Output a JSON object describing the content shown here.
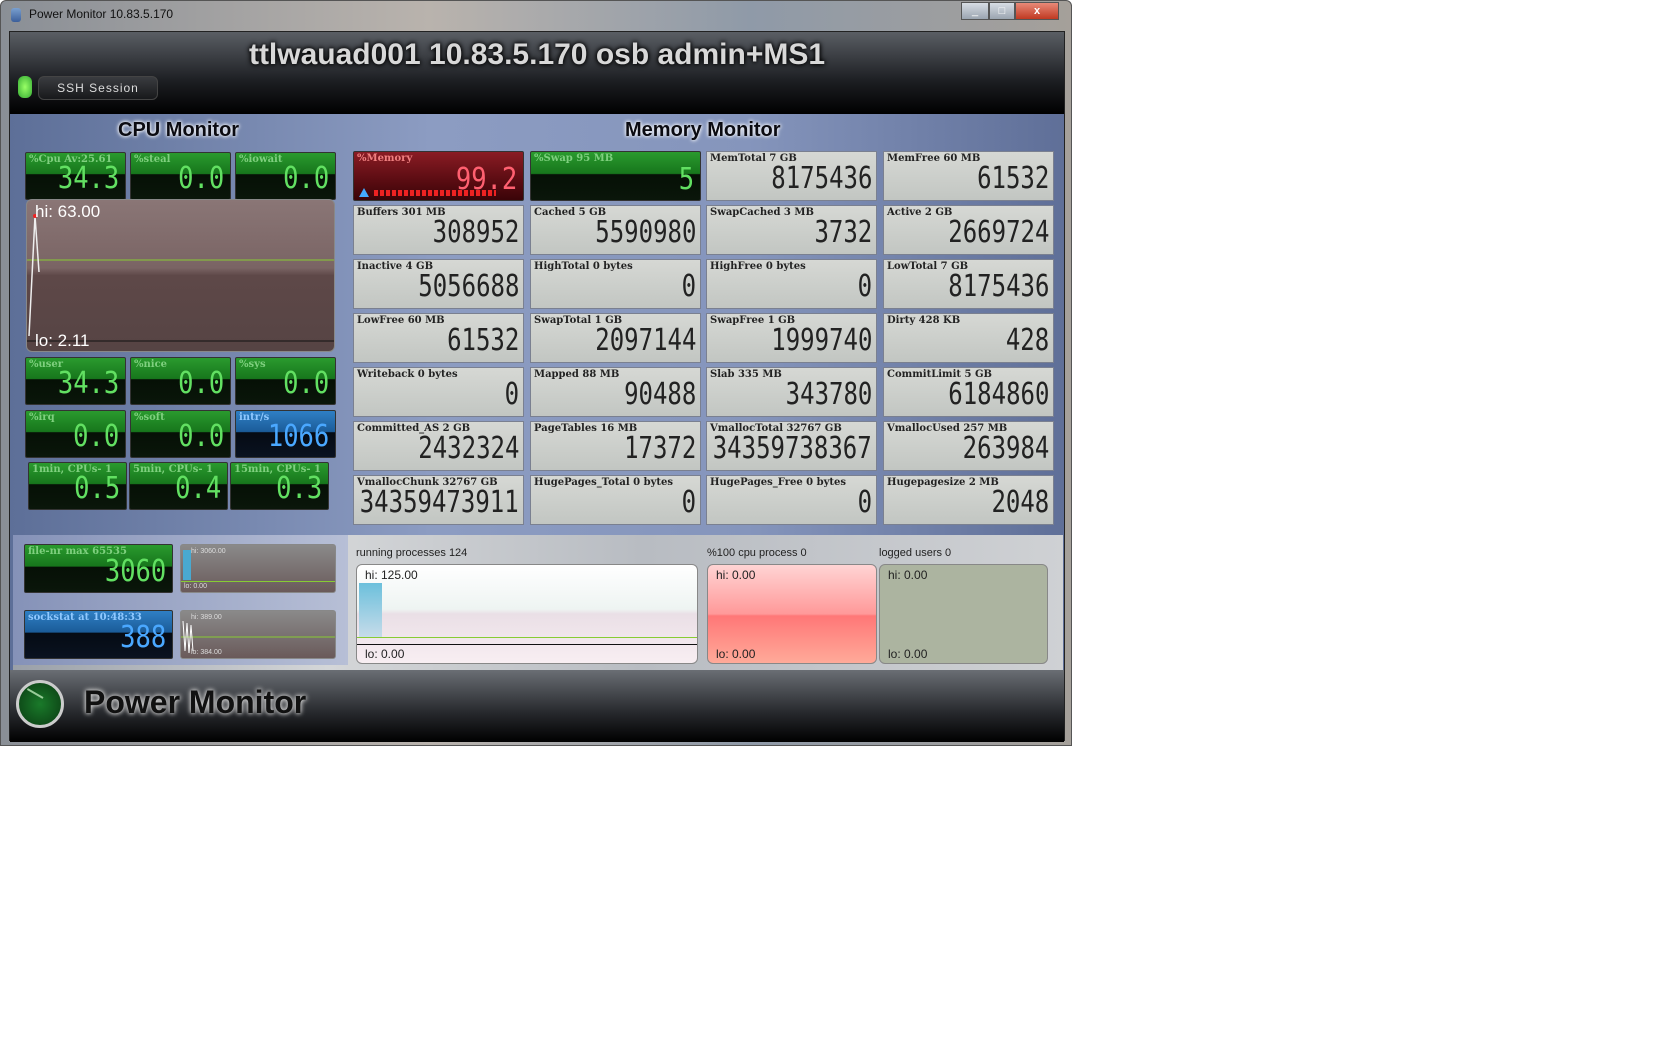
{
  "window": {
    "title": "Power Monitor 10.83.5.170",
    "minimize": "_",
    "maximize": "□",
    "close": "x"
  },
  "header": {
    "title": "ttlwauad001 10.83.5.170 osb admin+MS1",
    "ssh_button": "SSH Session"
  },
  "cpu": {
    "title": "CPU Monitor",
    "tiles": [
      {
        "label": "%Cpu Av:25.61",
        "value": "34.3",
        "style": "green"
      },
      {
        "label": "%steal",
        "value": "0.0",
        "style": "green"
      },
      {
        "label": "%iowait",
        "value": "0.0",
        "style": "green"
      },
      {
        "label": "%user",
        "value": "34.3",
        "style": "green"
      },
      {
        "label": "%nice",
        "value": "0.0",
        "style": "green"
      },
      {
        "label": "%sys",
        "value": "0.0",
        "style": "green"
      },
      {
        "label": "%irq",
        "value": "0.0",
        "style": "green"
      },
      {
        "label": "%soft",
        "value": "0.0",
        "style": "green"
      },
      {
        "label": "intr/s",
        "value": "1066",
        "style": "blue"
      },
      {
        "label": "1min, CPUs- 1",
        "value": "0.5",
        "style": "green"
      },
      {
        "label": "5min, CPUs- 1",
        "value": "0.4",
        "style": "green"
      },
      {
        "label": "15min, CPUs- 1",
        "value": "0.3",
        "style": "green"
      }
    ],
    "graph": {
      "hi": "hi: 63.00",
      "lo": "lo: 2.11"
    }
  },
  "memory": {
    "title": "Memory Monitor",
    "tiles": [
      {
        "label": "%Memory",
        "value": "99.2",
        "style": "red"
      },
      {
        "label": "%Swap 95 MB",
        "value": "5",
        "style": "green"
      },
      {
        "label": "MemTotal 7 GB",
        "value": "8175436"
      },
      {
        "label": "MemFree 60 MB",
        "value": "61532"
      },
      {
        "label": "Buffers 301 MB",
        "value": "308952"
      },
      {
        "label": "Cached 5 GB",
        "value": "5590980"
      },
      {
        "label": "SwapCached 3 MB",
        "value": "3732"
      },
      {
        "label": "Active 2 GB",
        "value": "2669724"
      },
      {
        "label": "Inactive 4 GB",
        "value": "5056688"
      },
      {
        "label": "HighTotal 0 bytes",
        "value": "0"
      },
      {
        "label": "HighFree 0 bytes",
        "value": "0"
      },
      {
        "label": "LowTotal 7 GB",
        "value": "8175436"
      },
      {
        "label": "LowFree 60 MB",
        "value": "61532"
      },
      {
        "label": "SwapTotal 1 GB",
        "value": "2097144"
      },
      {
        "label": "SwapFree 1 GB",
        "value": "1999740"
      },
      {
        "label": "Dirty 428 KB",
        "value": "428"
      },
      {
        "label": "Writeback 0 bytes",
        "value": "0"
      },
      {
        "label": "Mapped 88 MB",
        "value": "90488"
      },
      {
        "label": "Slab 335 MB",
        "value": "343780"
      },
      {
        "label": "CommitLimit 5 GB",
        "value": "6184860"
      },
      {
        "label": "Committed_AS 2 GB",
        "value": "2432324"
      },
      {
        "label": "PageTables 16 MB",
        "value": "17372"
      },
      {
        "label": "VmallocTotal 32767 GB",
        "value": "34359738367"
      },
      {
        "label": "VmallocUsed 257 MB",
        "value": "263984"
      },
      {
        "label": "VmallocChunk 32767 GB",
        "value": "34359473911"
      },
      {
        "label": "HugePages_Total 0 bytes",
        "value": "0"
      },
      {
        "label": "HugePages_Free 0 bytes",
        "value": "0"
      },
      {
        "label": "Hugepagesize 2 MB",
        "value": "2048"
      }
    ]
  },
  "files": {
    "label": "file-nr max 65535",
    "value": "3060",
    "graph_hi": "hi: 3060.00",
    "graph_lo": "lo: 0.00"
  },
  "sockstat": {
    "label": "sockstat at 10:48:33",
    "value": "388",
    "graph_hi": "hi: 389.00",
    "graph_lo": "lo: 384.00"
  },
  "processes": {
    "label": "running processes 124",
    "hi": "hi: 125.00",
    "lo": "lo: 0.00"
  },
  "cpu_process": {
    "label": "%100 cpu process 0",
    "hi": "hi: 0.00",
    "lo": "lo: 0.00"
  },
  "logged_users": {
    "label": "logged users 0",
    "hi": "hi: 0.00",
    "lo": "lo: 0.00"
  },
  "footer": {
    "title": "Power Monitor"
  },
  "colors": {
    "tile_green": "#17761c",
    "tile_blue": "#1b5c99",
    "tile_red": "#8a1c24",
    "memory_tile": "#c9ccc8"
  }
}
